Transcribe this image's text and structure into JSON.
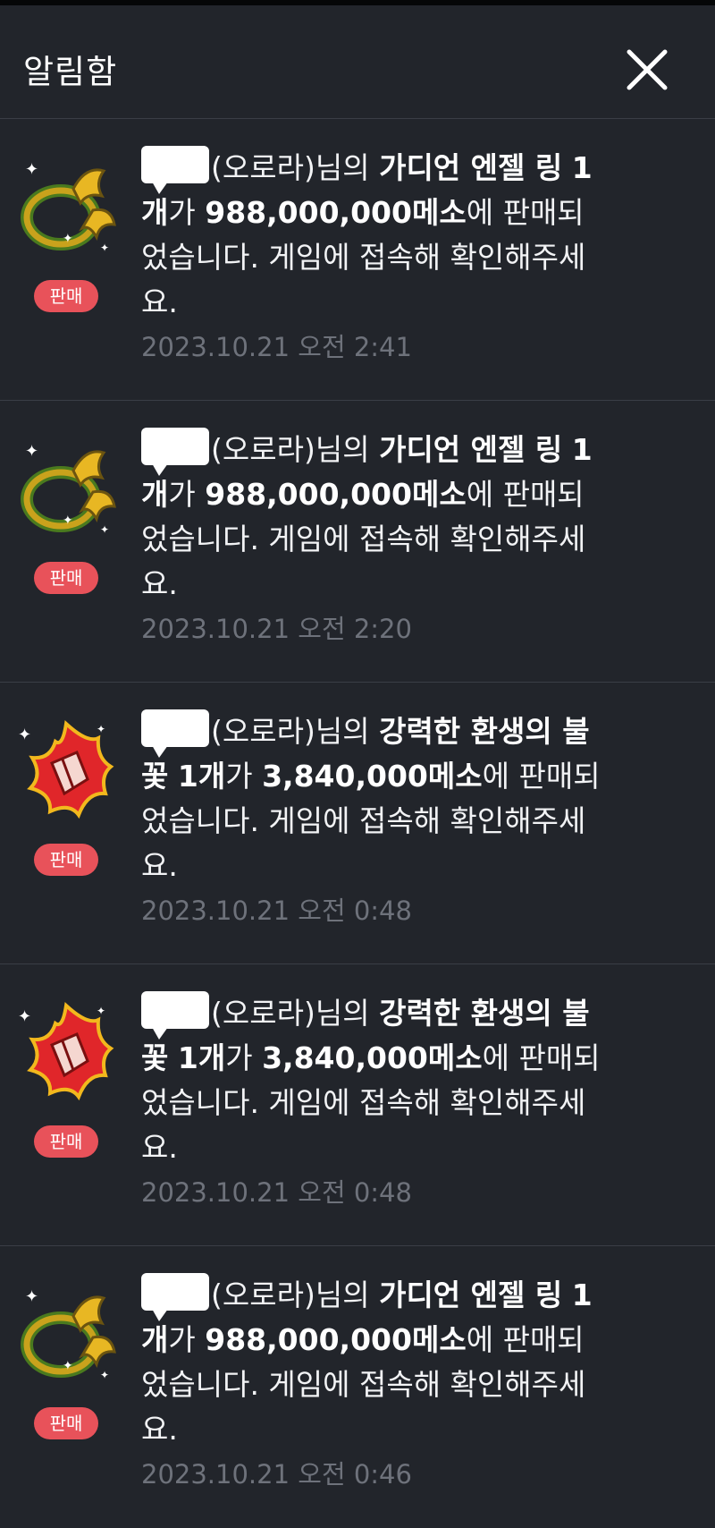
{
  "header": {
    "title": "알림함",
    "close_icon": "close-icon"
  },
  "badge_label": "판매",
  "notifications": [
    {
      "icon": "ring-icon",
      "server": "(오로라)",
      "honorific": "님의",
      "item_name": "가디언 엔젤 링",
      "quantity": "1개",
      "particle": "가",
      "price": "988,000,000메소",
      "price_suffix": "에",
      "message": "판매되었습니다. 게임에 접속해 확인해주세요.",
      "timestamp": "2023.10.21 오전 2:41"
    },
    {
      "icon": "ring-icon",
      "server": "(오로라)",
      "honorific": "님의",
      "item_name": "가디언 엔젤 링",
      "quantity": "1개",
      "particle": "가",
      "price": "988,000,000메소",
      "price_suffix": "에",
      "message": "판매되었습니다. 게임에 접속해 확인해주세요.",
      "timestamp": "2023.10.21 오전 2:20"
    },
    {
      "icon": "flame-icon",
      "server": "(오로라)",
      "honorific": "님의",
      "item_name": "강력한 환생의 불꽃",
      "quantity": "1개",
      "particle": "가",
      "price": "3,840,000메소",
      "price_suffix": "에",
      "message": "판매되었습니다. 게임에 접속해 확인해주세요.",
      "timestamp": "2023.10.21 오전 0:48"
    },
    {
      "icon": "flame-icon",
      "server": "(오로라)",
      "honorific": "님의",
      "item_name": "강력한 환생의 불꽃",
      "quantity": "1개",
      "particle": "가",
      "price": "3,840,000메소",
      "price_suffix": "에",
      "message": "판매되었습니다. 게임에 접속해 확인해주세요.",
      "timestamp": "2023.10.21 오전 0:48"
    },
    {
      "icon": "ring-icon",
      "server": "(오로라)",
      "honorific": "님의",
      "item_name": "가디언 엔젤 링",
      "quantity": "1개",
      "particle": "가",
      "price": "988,000,000메소",
      "price_suffix": "에",
      "message": "판매되었습니다. 게임에 접속해 확인해주세요.",
      "timestamp": "2023.10.21 오전 0:46"
    }
  ],
  "colors": {
    "background": "#22252b",
    "badge": "#e8525a",
    "timestamp": "#6e727b",
    "divider": "#3a3e46"
  }
}
